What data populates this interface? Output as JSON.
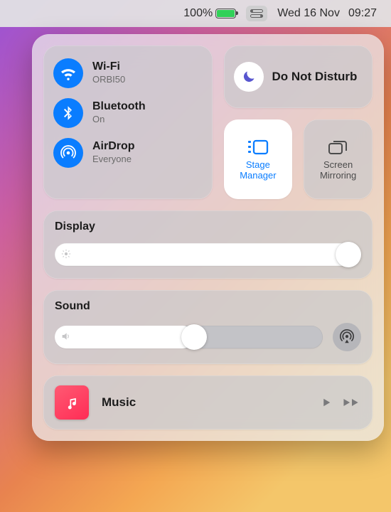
{
  "menubar": {
    "battery_pct": "100%",
    "date": "Wed 16 Nov",
    "time": "09:27"
  },
  "connectivity": {
    "wifi": {
      "label": "Wi-Fi",
      "sub": "ORBI50"
    },
    "bluetooth": {
      "label": "Bluetooth",
      "sub": "On"
    },
    "airdrop": {
      "label": "AirDrop",
      "sub": "Everyone"
    }
  },
  "dnd": {
    "label": "Do Not Disturb"
  },
  "tiles": {
    "stage_manager": {
      "label": "Stage Manager"
    },
    "screen_mirroring": {
      "label": "Screen Mirroring"
    }
  },
  "display": {
    "label": "Display",
    "value_pct": 100
  },
  "sound": {
    "label": "Sound",
    "value_pct": 52
  },
  "music": {
    "label": "Music"
  },
  "colors": {
    "accent_blue": "#0a7dff",
    "battery_green": "#31d158"
  }
}
